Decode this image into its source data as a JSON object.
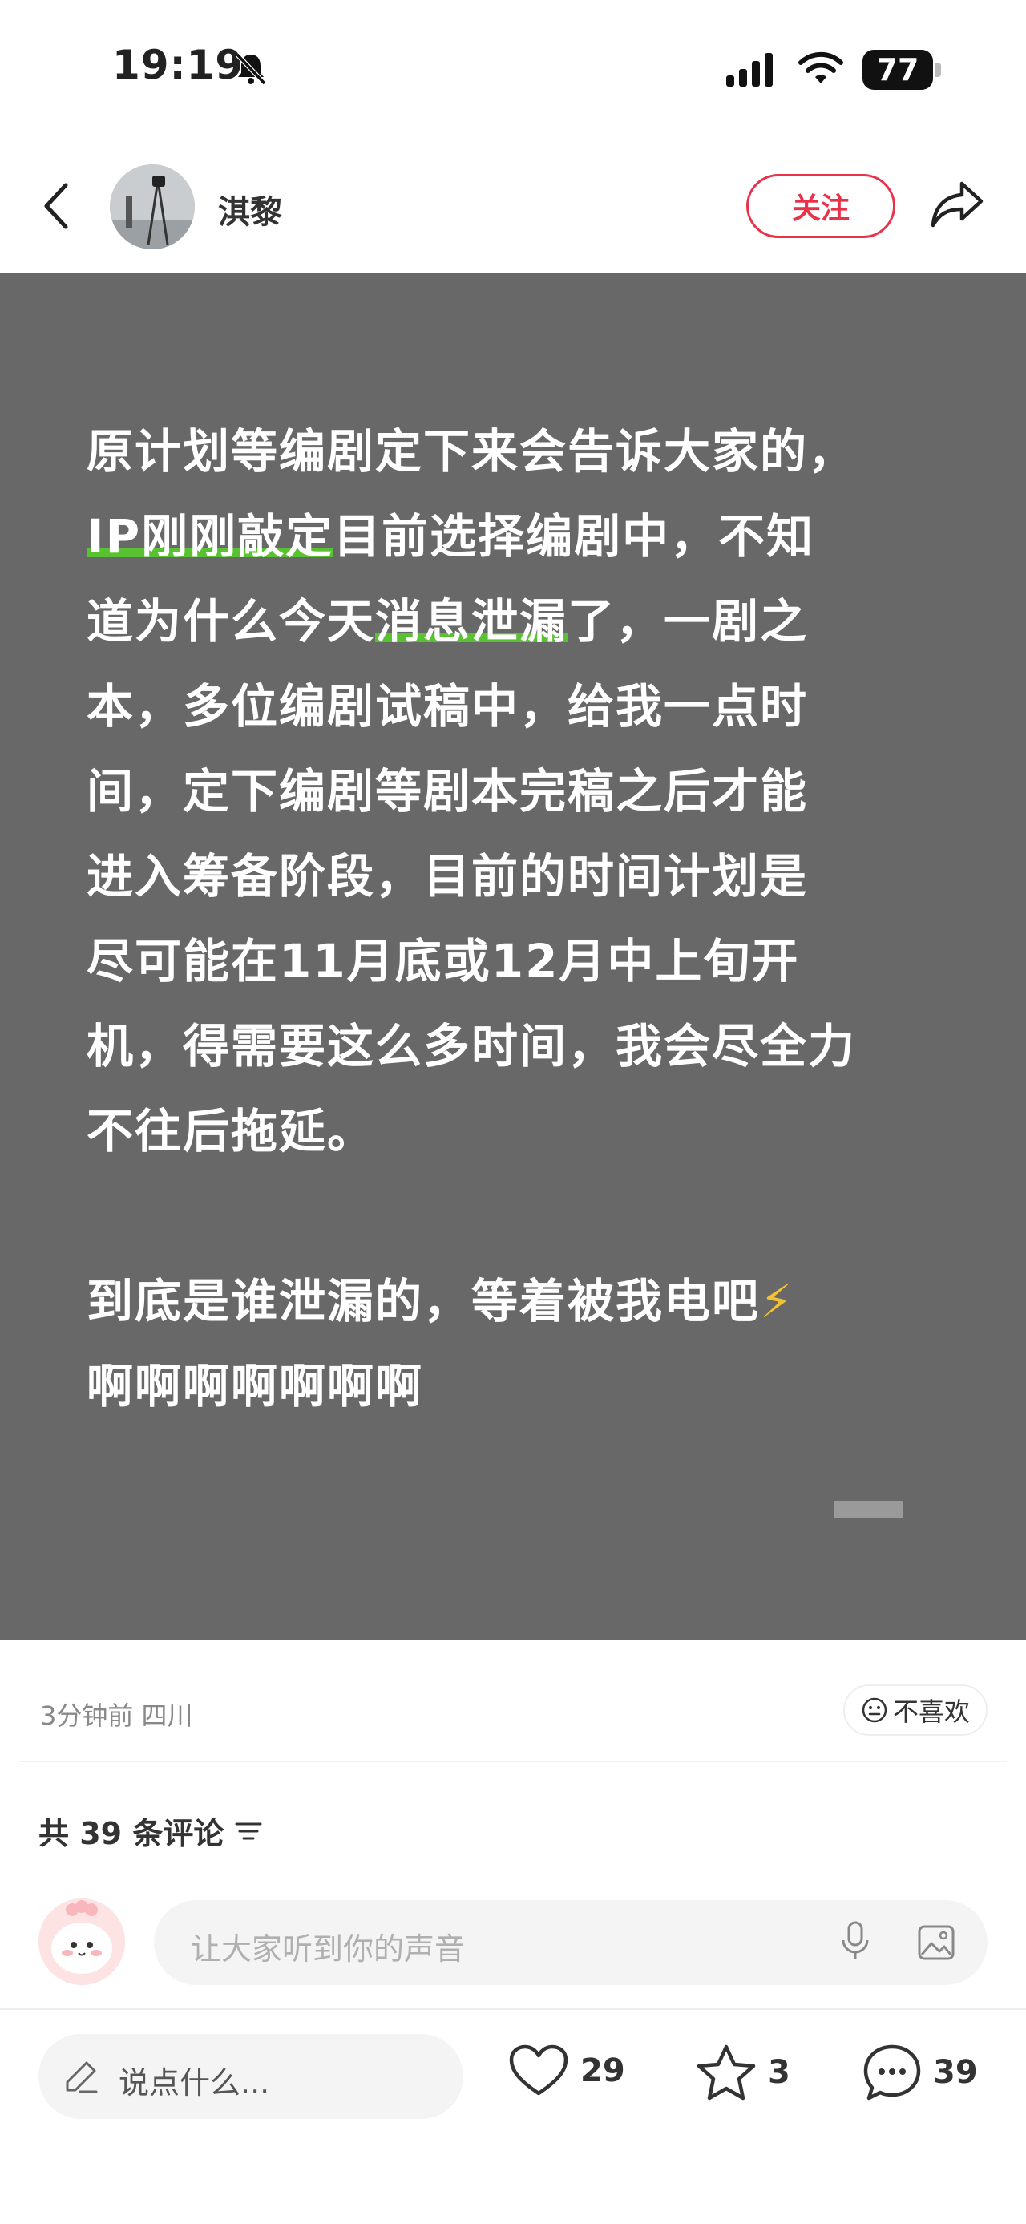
{
  "status_bar": {
    "time": "19:19",
    "battery": "77"
  },
  "nav": {
    "author": "淇黎",
    "follow_label": "关注"
  },
  "post": {
    "lines": [
      "原计划等编剧定下来会告诉大家的，",
      "目前选择编剧中，不知",
      "道为什么今天",
      "了，一剧之",
      "本，多位编剧试稿中，给我一点时",
      "间，定下编剧等剧本完稿之后才能",
      "进入筹备阶段，目前的时间计划是",
      "尽可能在11月底或12月中上旬开",
      "机，得需要这么多时间，我会尽全力",
      "不往后拖延。",
      "到底是谁泄漏的，等着被我电吧",
      "啊啊啊啊啊啊啊"
    ],
    "highlight_1": "IP刚刚敲定",
    "highlight_2": "消息泄漏",
    "emoji": "⚡"
  },
  "meta": {
    "time_location": "3分钟前 四川",
    "dislike_label": "不喜欢"
  },
  "comments": {
    "title": "共 39 条评论",
    "placeholder": "让大家听到你的声音"
  },
  "bottom_bar": {
    "say_placeholder": "说点什么...",
    "likes": "29",
    "stars": "3",
    "comments": "39"
  },
  "colors": {
    "accent": "#e8324a",
    "highlight": "#59c232",
    "post_bg": "#686868"
  }
}
